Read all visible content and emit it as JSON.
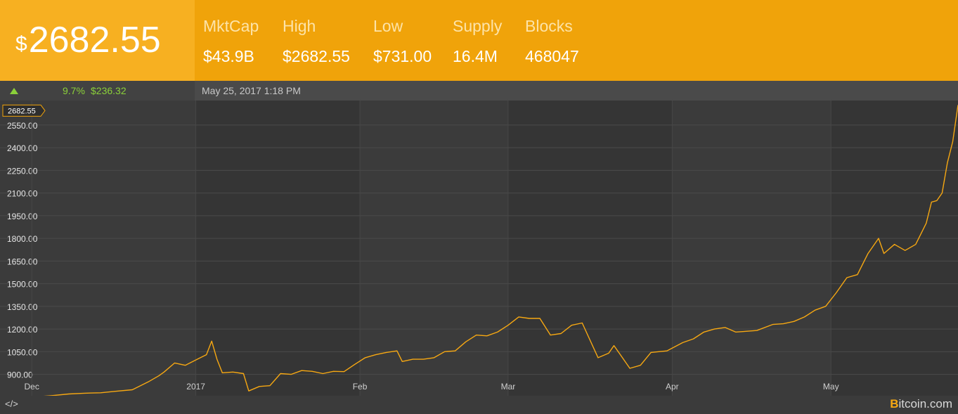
{
  "header": {
    "currency_symbol": "$",
    "price": "2682.55",
    "stats": [
      {
        "label": "MktCap",
        "value": "$43.9B"
      },
      {
        "label": "High",
        "value": "$2682.55"
      },
      {
        "label": "Low",
        "value": "$731.00"
      },
      {
        "label": "Supply",
        "value": "16.4M"
      },
      {
        "label": "Blocks",
        "value": "468047"
      }
    ]
  },
  "subbar": {
    "change_percent": "9.7%",
    "change_amount": "$236.32",
    "date": "May 25, 2017 1:18 PM"
  },
  "footer": {
    "embed_label": "</>",
    "brand_b": "B",
    "brand_rest": "itcoin.com"
  },
  "colors": {
    "header": "#f0a30a",
    "price_box": "#f7b021",
    "line": "#f7a812",
    "up": "#8bd03a"
  },
  "chart_data": {
    "type": "line",
    "title": "",
    "xlabel": "",
    "ylabel": "",
    "current_label": "2682.55",
    "ylim": [
      837.5,
      2703
    ],
    "xlim": [
      "2016-11-25",
      "2017-05-25"
    ],
    "yticks": [
      "900.00",
      "1050.00",
      "1200.00",
      "1350.00",
      "1500.00",
      "1650.00",
      "1800.00",
      "1950.00",
      "2100.00",
      "2250.00",
      "2400.00",
      "2550.00"
    ],
    "xticks": [
      {
        "date": "2016-12-01",
        "label": "Dec"
      },
      {
        "date": "2017-01-01",
        "label": "2017"
      },
      {
        "date": "2017-02-01",
        "label": "Feb"
      },
      {
        "date": "2017-03-01",
        "label": "Mar"
      },
      {
        "date": "2017-04-01",
        "label": "Apr"
      },
      {
        "date": "2017-05-01",
        "label": "May"
      }
    ],
    "grid": true,
    "series": [
      {
        "points": [
          [
            "2016-11-25",
            740
          ],
          [
            "2016-11-28",
            735
          ],
          [
            "2016-11-30",
            738
          ],
          [
            "2016-12-02",
            752
          ],
          [
            "2016-12-05",
            760
          ],
          [
            "2016-12-08",
            770
          ],
          [
            "2016-12-11",
            775
          ],
          [
            "2016-12-14",
            778
          ],
          [
            "2016-12-17",
            788
          ],
          [
            "2016-12-20",
            798
          ],
          [
            "2016-12-23",
            850
          ],
          [
            "2016-12-25",
            890
          ],
          [
            "2016-12-26",
            915
          ],
          [
            "2016-12-28",
            975
          ],
          [
            "2016-12-30",
            960
          ],
          [
            "2017-01-01",
            995
          ],
          [
            "2017-01-03",
            1030
          ],
          [
            "2017-01-04",
            1120
          ],
          [
            "2017-01-05",
            1000
          ],
          [
            "2017-01-06",
            910
          ],
          [
            "2017-01-08",
            915
          ],
          [
            "2017-01-10",
            905
          ],
          [
            "2017-01-11",
            790
          ],
          [
            "2017-01-13",
            820
          ],
          [
            "2017-01-15",
            825
          ],
          [
            "2017-01-17",
            905
          ],
          [
            "2017-01-19",
            900
          ],
          [
            "2017-01-21",
            925
          ],
          [
            "2017-01-23",
            920
          ],
          [
            "2017-01-25",
            905
          ],
          [
            "2017-01-27",
            920
          ],
          [
            "2017-01-29",
            918
          ],
          [
            "2017-01-31",
            965
          ],
          [
            "2017-02-02",
            1010
          ],
          [
            "2017-02-04",
            1030
          ],
          [
            "2017-02-06",
            1045
          ],
          [
            "2017-02-08",
            1055
          ],
          [
            "2017-02-09",
            985
          ],
          [
            "2017-02-11",
            1000
          ],
          [
            "2017-02-13",
            1000
          ],
          [
            "2017-02-15",
            1010
          ],
          [
            "2017-02-17",
            1050
          ],
          [
            "2017-02-19",
            1055
          ],
          [
            "2017-02-21",
            1115
          ],
          [
            "2017-02-23",
            1160
          ],
          [
            "2017-02-25",
            1155
          ],
          [
            "2017-02-27",
            1180
          ],
          [
            "2017-03-01",
            1225
          ],
          [
            "2017-03-03",
            1280
          ],
          [
            "2017-03-05",
            1270
          ],
          [
            "2017-03-07",
            1270
          ],
          [
            "2017-03-09",
            1160
          ],
          [
            "2017-03-11",
            1170
          ],
          [
            "2017-03-13",
            1225
          ],
          [
            "2017-03-15",
            1240
          ],
          [
            "2017-03-18",
            1010
          ],
          [
            "2017-03-20",
            1040
          ],
          [
            "2017-03-21",
            1090
          ],
          [
            "2017-03-22",
            1040
          ],
          [
            "2017-03-24",
            940
          ],
          [
            "2017-03-26",
            960
          ],
          [
            "2017-03-28",
            1045
          ],
          [
            "2017-03-31",
            1055
          ],
          [
            "2017-04-03",
            1110
          ],
          [
            "2017-04-05",
            1135
          ],
          [
            "2017-04-07",
            1180
          ],
          [
            "2017-04-09",
            1200
          ],
          [
            "2017-04-11",
            1210
          ],
          [
            "2017-04-13",
            1180
          ],
          [
            "2017-04-15",
            1185
          ],
          [
            "2017-04-17",
            1190
          ],
          [
            "2017-04-20",
            1230
          ],
          [
            "2017-04-22",
            1235
          ],
          [
            "2017-04-24",
            1250
          ],
          [
            "2017-04-26",
            1280
          ],
          [
            "2017-04-28",
            1325
          ],
          [
            "2017-04-30",
            1350
          ],
          [
            "2017-05-02",
            1440
          ],
          [
            "2017-05-04",
            1540
          ],
          [
            "2017-05-06",
            1560
          ],
          [
            "2017-05-08",
            1700
          ],
          [
            "2017-05-10",
            1800
          ],
          [
            "2017-05-11",
            1700
          ],
          [
            "2017-05-13",
            1760
          ],
          [
            "2017-05-15",
            1720
          ],
          [
            "2017-05-17",
            1760
          ],
          [
            "2017-05-19",
            1900
          ],
          [
            "2017-05-20",
            2040
          ],
          [
            "2017-05-21",
            2050
          ],
          [
            "2017-05-22",
            2100
          ],
          [
            "2017-05-23",
            2300
          ],
          [
            "2017-05-24",
            2440
          ],
          [
            "2017-05-25",
            2682.55
          ]
        ]
      }
    ]
  }
}
